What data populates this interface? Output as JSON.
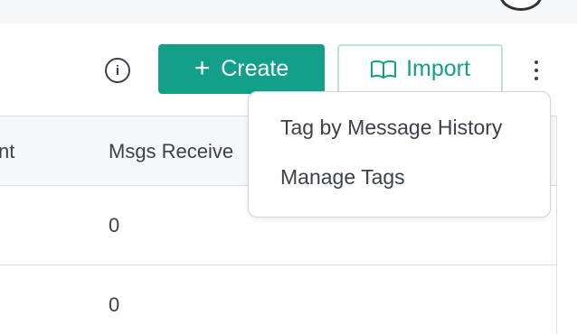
{
  "header": {
    "avatar_icon": "user-avatar-icon"
  },
  "toolbar": {
    "info_icon": "info-icon",
    "info_glyph": "i",
    "create_icon": "plus-icon",
    "create_label": "Create",
    "import_icon": "book-open-icon",
    "import_label": "Import",
    "more_icon": "kebab-vertical-icon"
  },
  "colors": {
    "accent": "#12a08a",
    "import_border": "#b9e3d9",
    "header_bg": "#f6f7f8",
    "border": "#dcdfe3",
    "text": "#3c4149"
  },
  "table": {
    "columns": [
      "nt",
      "Msgs Receive"
    ],
    "rows": [
      {
        "msgs_received": "0"
      },
      {
        "msgs_received": "0"
      }
    ]
  },
  "dropdown": {
    "items": [
      {
        "label": "Tag by Message History"
      },
      {
        "label": "Manage Tags"
      }
    ]
  }
}
